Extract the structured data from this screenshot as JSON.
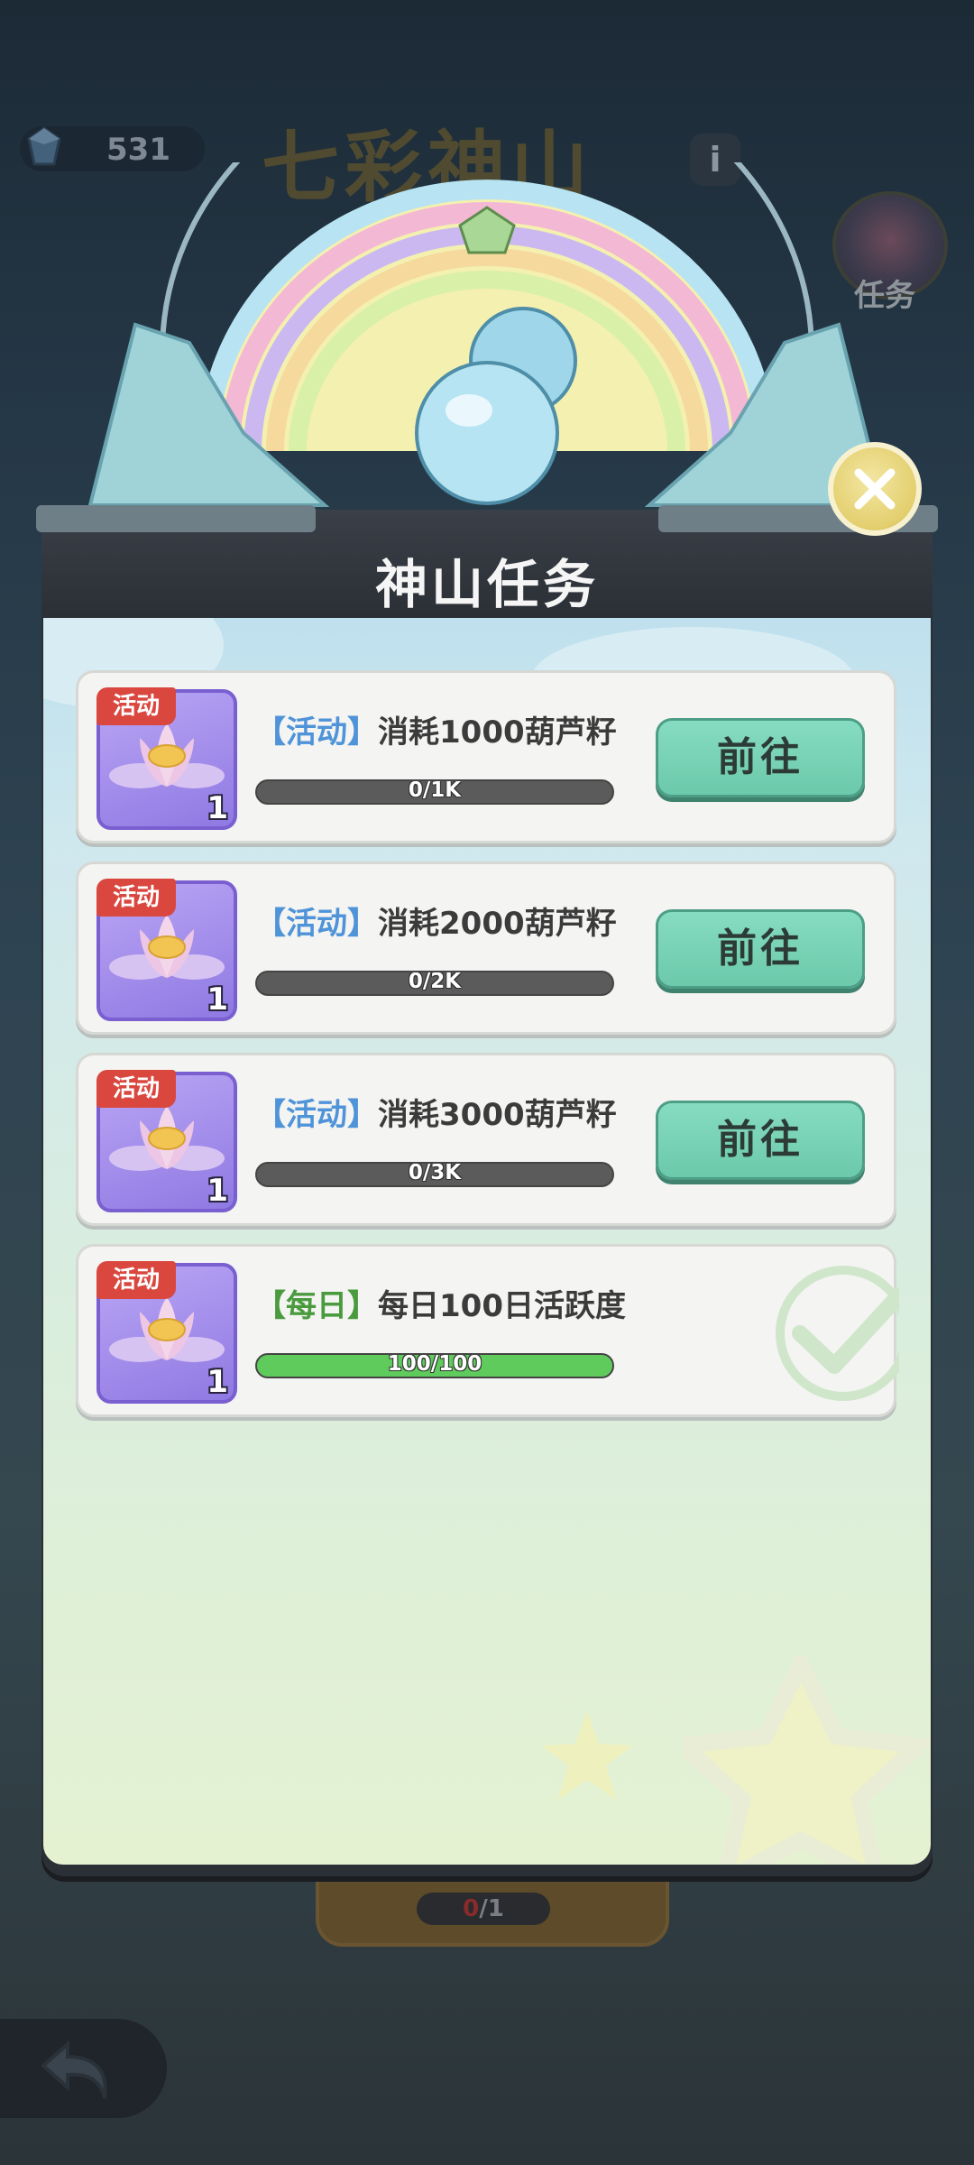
{
  "header": {
    "gem_count": "531",
    "game_title": "七彩神山",
    "info_label": "i",
    "task_button_label": "任务"
  },
  "modal": {
    "title": "神山任务",
    "tasks": [
      {
        "badge": "活动",
        "reward_count": "1",
        "reward_icon": "lotus-icon",
        "tag": "【活动】",
        "description": "消耗1000葫芦籽",
        "progress_text": "0/1K",
        "progress": 0,
        "action_label": "前往",
        "completed": false
      },
      {
        "badge": "活动",
        "reward_count": "1",
        "reward_icon": "lotus-icon",
        "tag": "【活动】",
        "description": "消耗2000葫芦籽",
        "progress_text": "0/2K",
        "progress": 0,
        "action_label": "前往",
        "completed": false
      },
      {
        "badge": "活动",
        "reward_count": "1",
        "reward_icon": "lotus-icon",
        "tag": "【活动】",
        "description": "消耗3000葫芦籽",
        "progress_text": "0/3K",
        "progress": 0,
        "action_label": "前往",
        "completed": false
      },
      {
        "badge": "活动",
        "reward_count": "1",
        "reward_icon": "lotus-icon",
        "tag": "【每日】",
        "description": "每日100日活跃度",
        "progress_text": "100/100",
        "progress": 1,
        "completed": true
      }
    ]
  },
  "background": {
    "bottom_progress_done": "0",
    "bottom_progress_total": "/1"
  },
  "colors": {
    "activity_tag": "#4f93d8",
    "daily_tag": "#4a9a3e",
    "go_button": "#76d2b4",
    "badge_red": "#d9473f",
    "progress_fill": "#5fcb5c"
  }
}
